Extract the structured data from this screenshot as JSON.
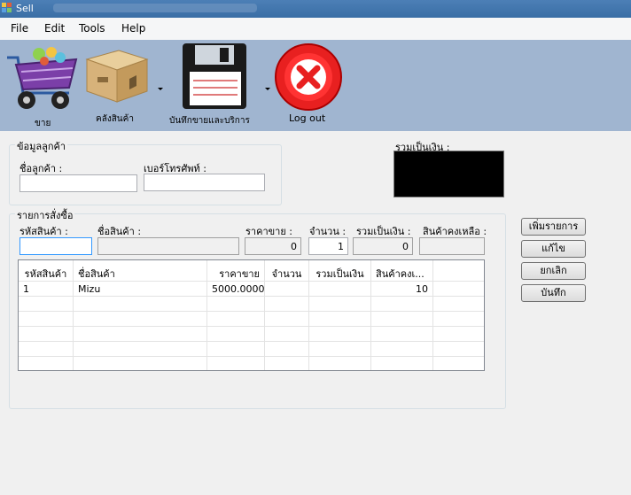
{
  "window": {
    "title": "Sell"
  },
  "menu": [
    "File",
    "Edit",
    "Tools",
    "Help"
  ],
  "toolbar": {
    "sell_label": "ขาย",
    "warehouse_label": "คลังสินค้า",
    "records_label": "บันทึกขายและบริการ",
    "logout_label": "Log out"
  },
  "customer_group": {
    "title": "ข้อมูลลูกค้า",
    "name_label": "ชื่อลูกค้า :",
    "name_value": "",
    "phone_label": "เบอร์โทรศัพท์ :",
    "phone_value": ""
  },
  "grand_total": {
    "label": "รวมเป็นเงิน :",
    "value": ""
  },
  "order_group": {
    "title": "รายการสั่งซื้อ",
    "code_label": "รหัสสินค้า :",
    "code_value": "",
    "product_name_label": "ชื่อสินค้า :",
    "product_name_value": "",
    "price_label": "ราคาขาย :",
    "price_value": "0",
    "qty_label": "จำนวน :",
    "qty_value": "1",
    "subtotal_label": "รวมเป็นเงิน :",
    "subtotal_value": "0",
    "stock_label": "สินค้าคงเหลือ :",
    "stock_value": ""
  },
  "table": {
    "columns": [
      "รหัสสินค้า",
      "ชื่อสินค้า",
      "ราคาขาย",
      "จำนวน",
      "รวมเป็นเงิน",
      "สินค้าคงเ..."
    ],
    "rows": [
      [
        "1",
        "Mizu",
        "5000.0000",
        "",
        "",
        "10"
      ]
    ]
  },
  "actions": {
    "add_label": "เพิ่มรายการ",
    "edit_label": "แก้ไข",
    "cancel_label": "ยกเลิก",
    "save_label": "บันทึก"
  },
  "colors": {
    "toolbar_bg": "#a0b5d0",
    "titlebar_bg": "#3a6ea5",
    "total_box": "#000000"
  }
}
